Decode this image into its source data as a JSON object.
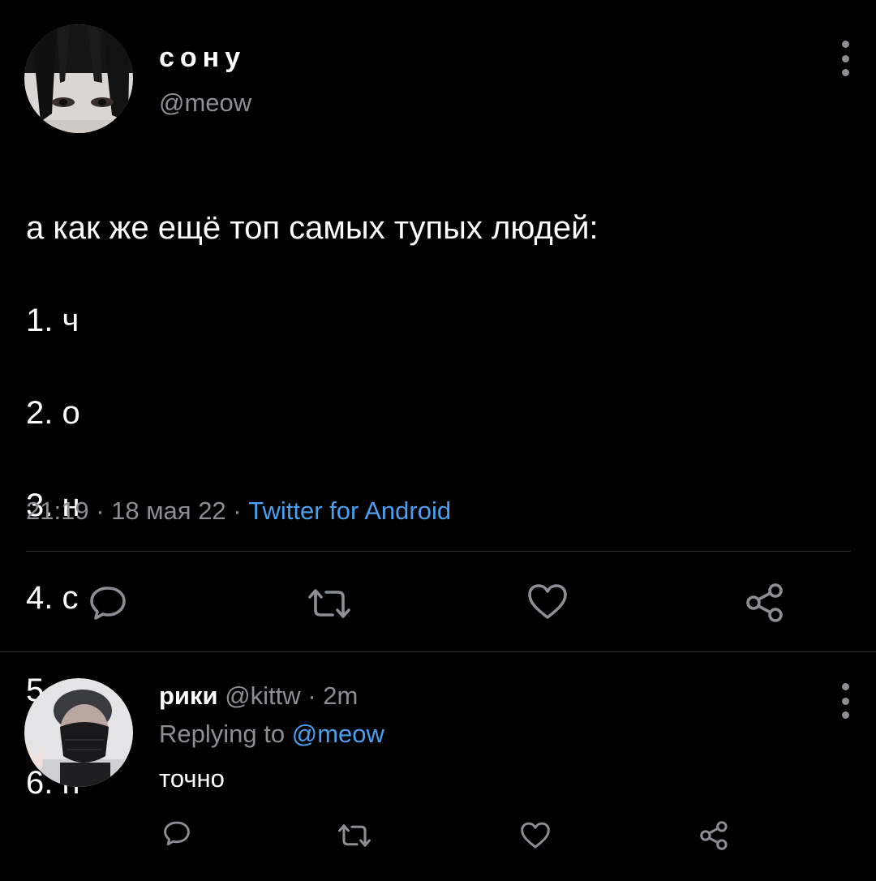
{
  "tweet": {
    "author": {
      "display_name": "сону",
      "handle": "@meow"
    },
    "text_lines": [
      "а как же ещё топ самых тупых людей:",
      "1. ч",
      "2. о",
      "3. н",
      "4. с",
      "5. о",
      "6. н"
    ],
    "meta": {
      "time": "21:19",
      "separator": " · ",
      "date": "18 мая 22",
      "source": "Twitter for Android"
    },
    "actions": [
      {
        "name": "reply",
        "icon": "comment-icon"
      },
      {
        "name": "retweet",
        "icon": "retweet-icon"
      },
      {
        "name": "like",
        "icon": "heart-icon"
      },
      {
        "name": "share",
        "icon": "share-icon"
      }
    ]
  },
  "reply": {
    "author": {
      "display_name": "рики",
      "handle": "@kittw"
    },
    "separator": " · ",
    "time": "2m",
    "replying_prefix": "Replying to ",
    "replying_to": "@meow",
    "text": "точно",
    "actions": [
      {
        "name": "reply",
        "icon": "comment-icon"
      },
      {
        "name": "retweet",
        "icon": "retweet-icon"
      },
      {
        "name": "like",
        "icon": "heart-icon"
      },
      {
        "name": "share",
        "icon": "share-icon"
      }
    ]
  },
  "colors": {
    "background": "#000000",
    "text_primary": "#ffffff",
    "text_secondary": "#8b8f94",
    "link": "#4a9ff0",
    "divider": "#2b2f33"
  }
}
